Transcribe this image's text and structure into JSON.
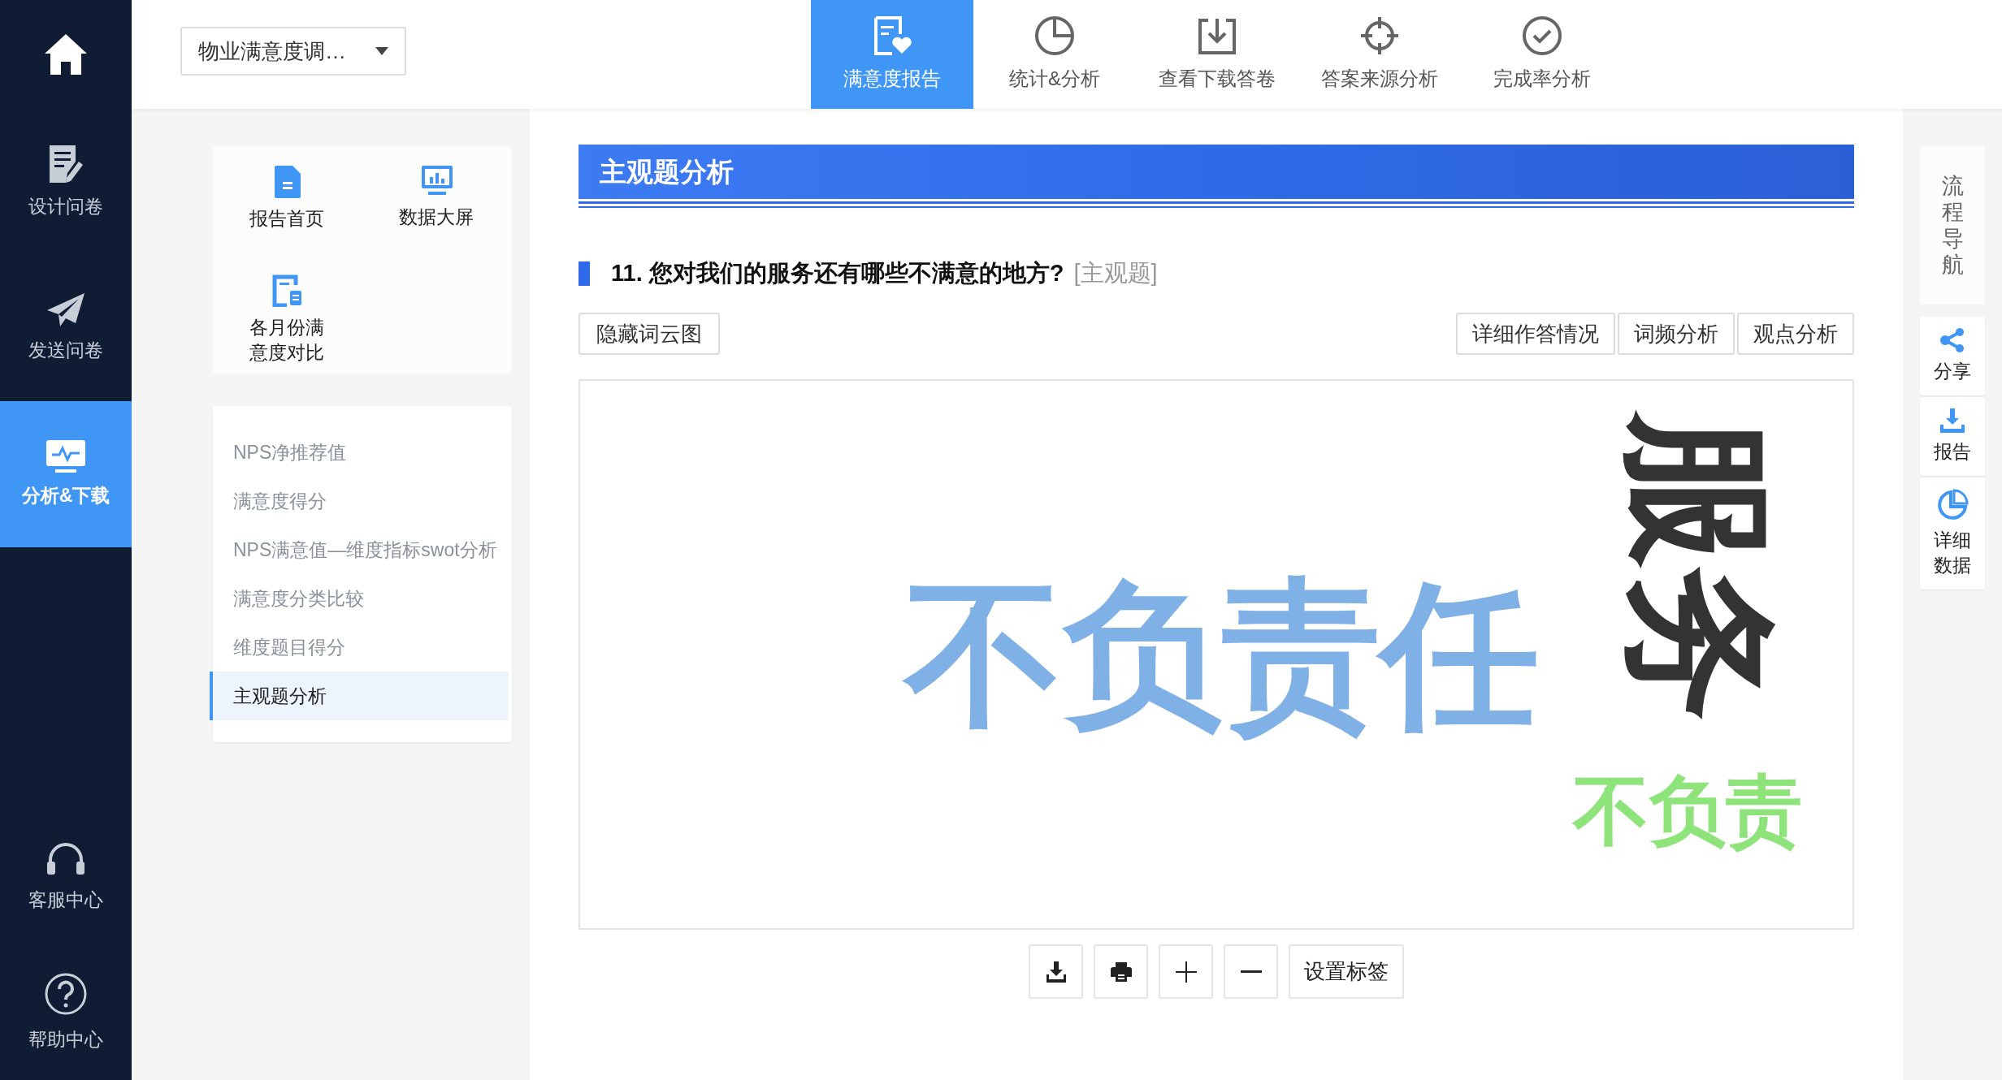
{
  "sidebar": {
    "nav_items": [
      {
        "label": "设计问卷",
        "selected": false
      },
      {
        "label": "发送问卷",
        "selected": false
      },
      {
        "label": "分析&下载",
        "selected": true
      }
    ],
    "bottom_items": [
      {
        "label": "客服中心"
      },
      {
        "label": "帮助中心"
      }
    ]
  },
  "survey_select": {
    "value": "物业满意度调…"
  },
  "tabs": [
    {
      "label": "满意度报告",
      "selected": true
    },
    {
      "label": "统计&分析",
      "selected": false
    },
    {
      "label": "查看下载答卷",
      "selected": false
    },
    {
      "label": "答案来源分析",
      "selected": false
    },
    {
      "label": "完成率分析",
      "selected": false
    }
  ],
  "report_tiles": [
    {
      "label": "报告首页"
    },
    {
      "label": "数据大屏"
    },
    {
      "label": "各月份满意度对比"
    }
  ],
  "sections": [
    {
      "label": "NPS净推荐值",
      "selected": false
    },
    {
      "label": "满意度得分",
      "selected": false
    },
    {
      "label": "NPS满意值—维度指标swot分析",
      "selected": false
    },
    {
      "label": "满意度分类比较",
      "selected": false
    },
    {
      "label": "维度题目得分",
      "selected": false
    },
    {
      "label": "主观题分析",
      "selected": true
    }
  ],
  "banner": {
    "title": "主观题分析"
  },
  "question": {
    "text": "11. 您对我们的服务还有哪些不满意的地方?",
    "tag": "[主观题]"
  },
  "left_button": "隐藏词云图",
  "view_buttons": [
    "详细作答情况",
    "词频分析",
    "观点分析"
  ],
  "word_cloud": [
    {
      "text": "不负责任",
      "color": "#80b1e6",
      "rotated": false
    },
    {
      "text": "服务",
      "color": "#333333",
      "rotated": true
    },
    {
      "text": "不负责",
      "color": "#8ee37a",
      "rotated": false
    }
  ],
  "toolbar": {
    "label_button": "设置标签"
  },
  "right_rail": {
    "nav_label": "流程导航",
    "actions": [
      {
        "label": "分享"
      },
      {
        "label": "报告"
      },
      {
        "label": "详细数据"
      }
    ]
  }
}
